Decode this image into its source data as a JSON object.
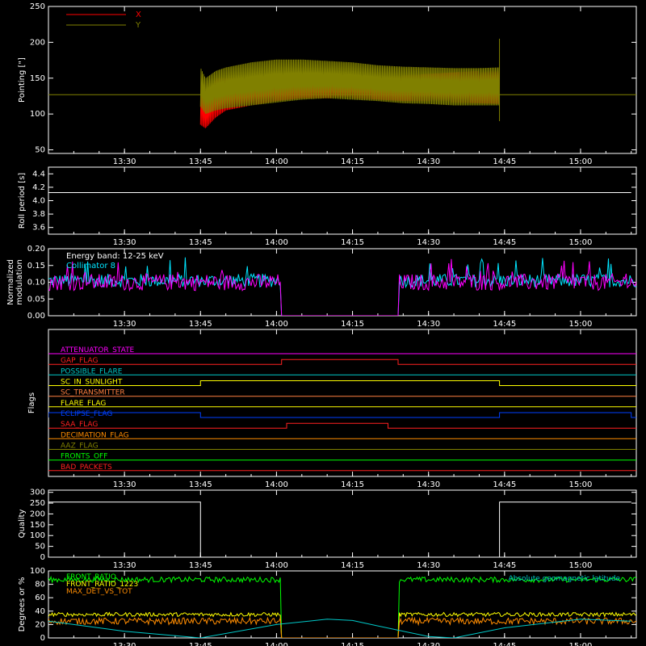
{
  "colors": {
    "background": "#000000",
    "axes": "#ffffff",
    "x_series": "#ff0000",
    "y_series": "#808000",
    "modulation": "#ff00ff",
    "collimator": "#00e5ff",
    "front_ratio": "#00ff00",
    "rear_ratio": "#ffff00",
    "max_det": "#ff8c00",
    "geomag": "#00c8c8"
  },
  "chart_data": [
    {
      "id": "pointing",
      "type": "line",
      "ylabel": "Pointing [\"]",
      "ylim": [
        45,
        250
      ],
      "yticks": [
        50,
        100,
        150,
        200,
        250
      ],
      "xlim_minutes": [
        -15,
        101
      ],
      "xticks": [
        "13:30",
        "13:45",
        "14:00",
        "14:15",
        "14:30",
        "14:45",
        "15:00"
      ],
      "xtick_minutes": [
        0,
        15,
        30,
        45,
        60,
        75,
        90
      ],
      "legend": [
        {
          "name": "X",
          "color": "#ff0000"
        },
        {
          "name": "Y",
          "color": "#808000"
        }
      ],
      "baseline": 127,
      "active_range": [
        "13:45",
        "14:44"
      ],
      "series": [
        {
          "name": "X",
          "color": "#ff0000",
          "x": [
            "13:45",
            "13:46",
            "13:48",
            "13:50",
            "13:55",
            "14:00",
            "14:05",
            "14:10",
            "14:15",
            "14:20",
            "14:25",
            "14:30",
            "14:35",
            "14:40",
            "14:44"
          ],
          "upper": [
            145,
            120,
            150,
            150,
            150,
            148,
            148,
            148,
            150,
            152,
            154,
            156,
            158,
            160,
            162
          ],
          "lower": [
            85,
            80,
            95,
            105,
            112,
            118,
            122,
            122,
            122,
            120,
            118,
            118,
            116,
            115,
            114
          ]
        },
        {
          "name": "Y",
          "color": "#808000",
          "x": [
            "13:45",
            "13:46",
            "13:48",
            "13:50",
            "13:55",
            "14:00",
            "14:05",
            "14:10",
            "14:15",
            "14:20",
            "14:25",
            "14:30",
            "14:35",
            "14:40",
            "14:44"
          ],
          "upper": [
            165,
            150,
            160,
            165,
            172,
            176,
            176,
            174,
            172,
            168,
            166,
            165,
            164,
            164,
            165
          ],
          "lower": [
            110,
            100,
            105,
            108,
            112,
            116,
            120,
            122,
            120,
            118,
            115,
            114,
            112,
            112,
            112
          ]
        }
      ]
    },
    {
      "id": "roll",
      "type": "line",
      "ylabel": "Roll period [s]",
      "ylim": [
        3.5,
        4.5
      ],
      "yticks": [
        3.6,
        3.8,
        4.0,
        4.2,
        4.4
      ],
      "ytick_labels": [
        "3.6",
        "3.8",
        "4.0",
        "4.2",
        "4.4"
      ],
      "xlim_minutes": [
        -15,
        101
      ],
      "xticks": [
        "13:30",
        "13:45",
        "14:00",
        "14:15",
        "14:30",
        "14:45",
        "15:00"
      ],
      "xtick_minutes": [
        0,
        15,
        30,
        45,
        60,
        75,
        90
      ],
      "series": [
        {
          "name": "",
          "color": "#ffffff",
          "x": [
            "13:15",
            "15:10"
          ],
          "y": [
            4.12,
            4.12
          ]
        }
      ]
    },
    {
      "id": "modulation",
      "type": "line",
      "ylabel": "Normalized modulation",
      "ylabel_lines": [
        "Normalized",
        "modulation"
      ],
      "ylim": [
        0,
        0.2
      ],
      "yticks": [
        0,
        0.05,
        0.1,
        0.15,
        0.2
      ],
      "ytick_labels": [
        "0.00",
        "0.05",
        "0.10",
        "0.15",
        "0.20"
      ],
      "xlim_minutes": [
        -15,
        101
      ],
      "xticks": [
        "13:30",
        "13:45",
        "14:00",
        "14:15",
        "14:30",
        "14:45",
        "15:00"
      ],
      "xtick_minutes": [
        0,
        15,
        30,
        45,
        60,
        75,
        90
      ],
      "annotations": [
        "Energy band: 12-25 keV",
        "Collimator 8"
      ],
      "gap_range": [
        "14:01",
        "14:24"
      ],
      "series": [
        {
          "name": "Collimator 8",
          "color": "#00e5ff",
          "mean": 0.105,
          "noise": 0.02
        },
        {
          "name": "",
          "color": "#ff00ff",
          "mean": 0.1,
          "noise": 0.025
        }
      ]
    },
    {
      "id": "flags",
      "type": "step",
      "ylabel": "Flags",
      "xlim_minutes": [
        -15,
        101
      ],
      "xticks": [
        "13:30",
        "13:45",
        "14:00",
        "14:15",
        "14:30",
        "14:45",
        "15:00"
      ],
      "xtick_minutes": [
        0,
        15,
        30,
        45,
        60,
        75,
        90
      ],
      "flags": [
        {
          "name": "ATTENUATOR_STATE",
          "color": "#ff00ff",
          "high": [],
          "level": 0
        },
        {
          "name": "GAP_FLAG",
          "color": "#ff2020",
          "high": [
            [
              "14:01",
              "14:24"
            ]
          ],
          "level": 0
        },
        {
          "name": "POSSIBLE_FLARE",
          "color": "#00c8c8",
          "high": [],
          "level": 0
        },
        {
          "name": "SC_IN_SUNLIGHT",
          "color": "#ffff00",
          "high": [
            [
              "13:45",
              "14:44"
            ]
          ],
          "level": 0
        },
        {
          "name": "SC_TRANSMITTER",
          "color": "#ff8040",
          "high": [],
          "level": 0
        },
        {
          "name": "FLARE_FLAG",
          "color": "#ffff00",
          "high": [],
          "level": 0
        },
        {
          "name": "ECLIPSE_FLAG",
          "color": "#0040ff",
          "high": [
            [
              "13:15",
              "13:45"
            ],
            [
              "14:44",
              "15:10"
            ]
          ],
          "level": 0
        },
        {
          "name": "SAA_FLAG",
          "color": "#ff2020",
          "high": [
            [
              "14:02",
              "14:22"
            ]
          ],
          "level": 0
        },
        {
          "name": "DECIMATION_FLAG",
          "color": "#ff8c00",
          "high": [],
          "level": 0
        },
        {
          "name": "AAZ_FLAG",
          "color": "#808000",
          "high": [],
          "level": 0
        },
        {
          "name": "FRONTS_OFF",
          "color": "#00ff00",
          "high": [],
          "level": 0
        },
        {
          "name": "BAD_PACKETS",
          "color": "#ff2020",
          "high": [],
          "level": 0
        }
      ]
    },
    {
      "id": "quality",
      "type": "line",
      "ylabel": "Quality",
      "ylim": [
        0,
        310
      ],
      "yticks": [
        0,
        50,
        100,
        150,
        200,
        250,
        300
      ],
      "ytick_labels": [
        "0",
        "50",
        "100",
        "150",
        "200",
        "250",
        "300"
      ],
      "xlim_minutes": [
        -15,
        101
      ],
      "xticks": [
        "13:30",
        "13:45",
        "14:00",
        "14:15",
        "14:30",
        "14:45",
        "15:00"
      ],
      "xtick_minutes": [
        0,
        15,
        30,
        45,
        60,
        75,
        90
      ],
      "series": [
        {
          "name": "",
          "color": "#ffffff",
          "x": [
            "13:15",
            "13:45",
            "13:45",
            "14:44",
            "14:44",
            "15:10"
          ],
          "y": [
            255,
            255,
            0,
            0,
            255,
            255
          ]
        }
      ]
    },
    {
      "id": "ratios",
      "type": "line",
      "ylabel": "Degrees or %",
      "ylim": [
        0,
        100
      ],
      "yticks": [
        0,
        20,
        40,
        60,
        80,
        100
      ],
      "ytick_labels": [
        "0",
        "20",
        "40",
        "60",
        "80",
        "100"
      ],
      "xlim_minutes": [
        -15,
        101
      ],
      "xticks": [
        "13:30",
        "13:45",
        "14:00",
        "14:15",
        "14:30",
        "14:45",
        "15:00"
      ],
      "xtick_minutes": [
        0,
        15,
        30,
        45,
        60,
        75,
        90
      ],
      "legend": [
        {
          "name": "FRONT_RATIO",
          "color": "#00ff00"
        },
        {
          "name": "FRONT_RATIO_1223",
          "color": "#ffff00"
        },
        {
          "name": "MAX_DET_VS_TOT",
          "color": "#ff8c00"
        },
        {
          "name": "Absolute geomagnetic latitude",
          "color": "#00c8c8"
        }
      ],
      "gap_range": [
        "14:01",
        "14:24"
      ],
      "series": [
        {
          "name": "FRONT_RATIO",
          "color": "#00ff00",
          "mean": 87,
          "noise": 4
        },
        {
          "name": "FRONT_RATIO_1223",
          "color": "#ffff00",
          "mean": 35,
          "noise": 3
        },
        {
          "name": "MAX_DET_VS_TOT",
          "color": "#ff8c00",
          "mean": 25,
          "noise": 5
        },
        {
          "name": "Absolute geomagnetic latitude",
          "color": "#00c8c8",
          "x": [
            "13:15",
            "13:30",
            "13:45",
            "14:00",
            "14:10",
            "14:15",
            "14:20",
            "14:30",
            "14:35",
            "14:45",
            "15:00",
            "15:10"
          ],
          "y": [
            25,
            10,
            0,
            20,
            28,
            26,
            18,
            2,
            0,
            15,
            28,
            25
          ]
        }
      ]
    }
  ]
}
